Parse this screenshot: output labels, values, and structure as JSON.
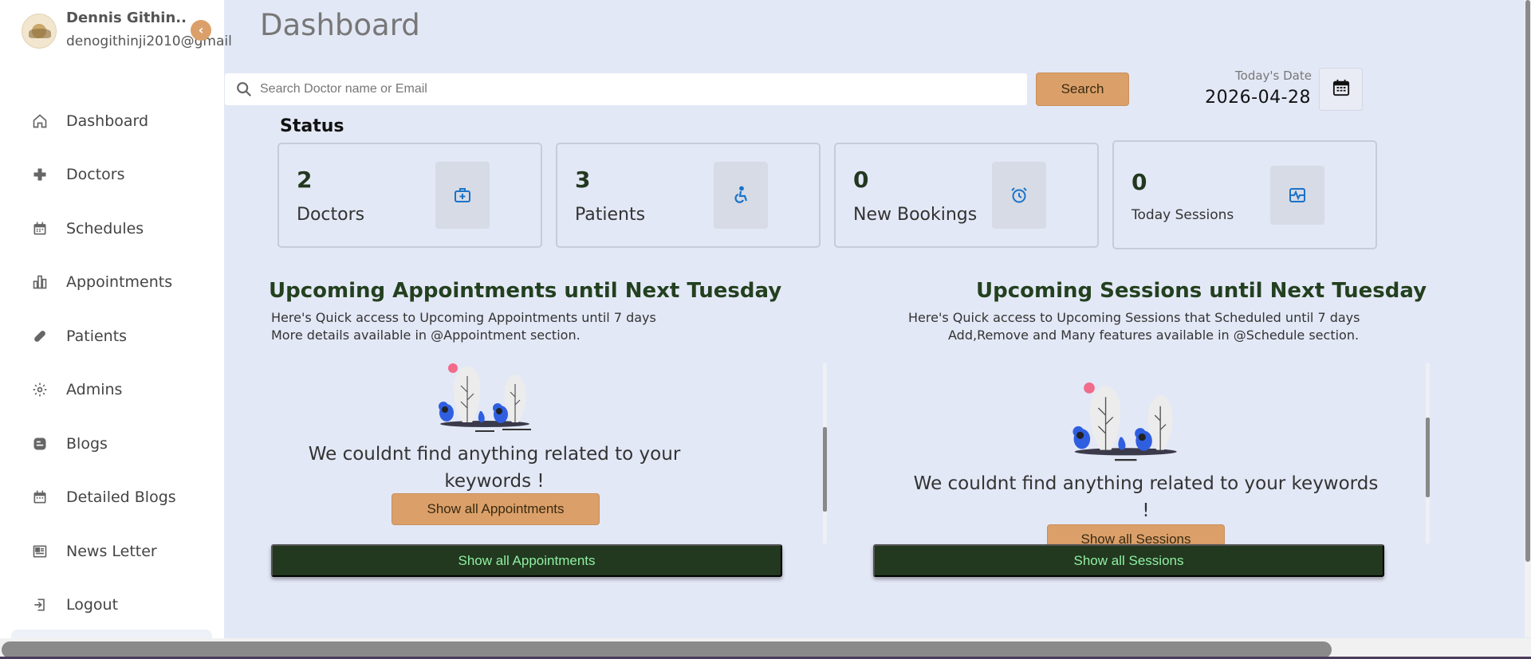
{
  "profile": {
    "name": "Dennis Githin..",
    "email": "denogithinji2010@gmail"
  },
  "sidebar": {
    "items": [
      {
        "label": "Dashboard",
        "icon": "home-icon"
      },
      {
        "label": "Doctors",
        "icon": "plus-icon"
      },
      {
        "label": "Schedules",
        "icon": "calendar-icon"
      },
      {
        "label": "Appointments",
        "icon": "bar-chart-icon"
      },
      {
        "label": "Patients",
        "icon": "pill-icon"
      },
      {
        "label": "Admins",
        "icon": "gear-icon"
      },
      {
        "label": "Blogs",
        "icon": "blog-icon"
      },
      {
        "label": "Detailed Blogs",
        "icon": "calendar-icon"
      },
      {
        "label": "News Letter",
        "icon": "newspaper-icon"
      },
      {
        "label": "Logout",
        "icon": "logout-icon"
      }
    ]
  },
  "header": {
    "title": "Dashboard"
  },
  "search": {
    "placeholder": "Search Doctor name or Email",
    "button_label": "Search"
  },
  "date": {
    "label": "Today's Date",
    "value": "2026-04-28"
  },
  "status": {
    "title": "Status",
    "cards": [
      {
        "value": "2",
        "label": "Doctors",
        "icon": "medical-kit-icon"
      },
      {
        "value": "3",
        "label": "Patients",
        "icon": "wheelchair-icon"
      },
      {
        "value": "0",
        "label": "New Bookings",
        "icon": "alarm-clock-icon"
      },
      {
        "value": "0",
        "label": "Today Sessions",
        "icon": "pulse-icon"
      }
    ]
  },
  "appointments": {
    "title": "Upcoming Appointments until Next Tuesday",
    "desc_line1": "Here's Quick access to Upcoming Appointments until 7 days",
    "desc_line2": "More details available in @Appointment section.",
    "empty_message": "We couldnt find anything related to your keywords !",
    "show_all_label": "Show all Appointments",
    "footer_button_label": "Show all Appointments"
  },
  "sessions": {
    "title": "Upcoming Sessions until Next Tuesday",
    "desc_line1": "Here's Quick access to Upcoming Sessions that Scheduled until 7 days",
    "desc_line2": "Add,Remove and Many features available in @Schedule section.",
    "empty_message": "We couldnt find anything related to your keywords !",
    "show_all_label": "Show all Sessions",
    "footer_button_label": "Show all Sessions"
  },
  "colors": {
    "accent": "#dba06a",
    "dark_green": "#22381f",
    "background": "#e3e8f6",
    "icon_blue": "#1a73c8"
  }
}
